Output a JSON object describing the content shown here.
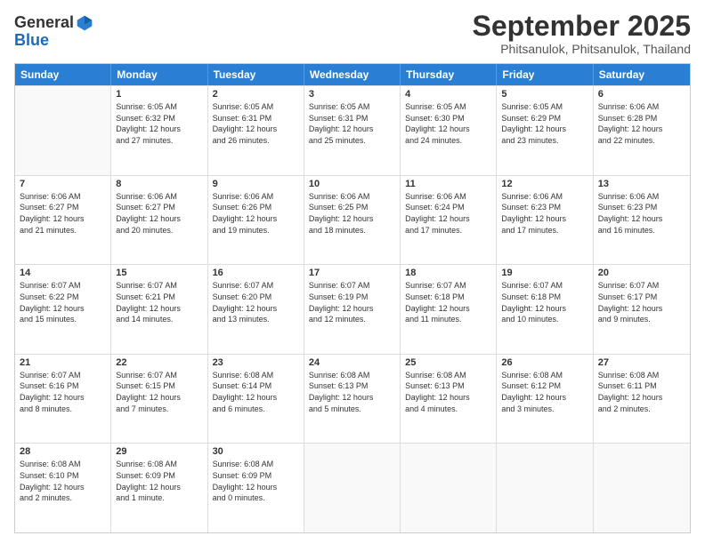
{
  "header": {
    "logo_line1": "General",
    "logo_line2": "Blue",
    "month_title": "September 2025",
    "location": "Phitsanulok, Phitsanulok, Thailand"
  },
  "weekdays": [
    "Sunday",
    "Monday",
    "Tuesday",
    "Wednesday",
    "Thursday",
    "Friday",
    "Saturday"
  ],
  "weeks": [
    [
      {
        "day": "",
        "empty": true
      },
      {
        "day": "1",
        "sunrise": "6:05 AM",
        "sunset": "6:32 PM",
        "daylight": "12 hours and 27 minutes."
      },
      {
        "day": "2",
        "sunrise": "6:05 AM",
        "sunset": "6:31 PM",
        "daylight": "12 hours and 26 minutes."
      },
      {
        "day": "3",
        "sunrise": "6:05 AM",
        "sunset": "6:31 PM",
        "daylight": "12 hours and 25 minutes."
      },
      {
        "day": "4",
        "sunrise": "6:05 AM",
        "sunset": "6:30 PM",
        "daylight": "12 hours and 24 minutes."
      },
      {
        "day": "5",
        "sunrise": "6:05 AM",
        "sunset": "6:29 PM",
        "daylight": "12 hours and 23 minutes."
      },
      {
        "day": "6",
        "sunrise": "6:06 AM",
        "sunset": "6:28 PM",
        "daylight": "12 hours and 22 minutes."
      }
    ],
    [
      {
        "day": "7",
        "sunrise": "6:06 AM",
        "sunset": "6:27 PM",
        "daylight": "12 hours and 21 minutes."
      },
      {
        "day": "8",
        "sunrise": "6:06 AM",
        "sunset": "6:27 PM",
        "daylight": "12 hours and 20 minutes."
      },
      {
        "day": "9",
        "sunrise": "6:06 AM",
        "sunset": "6:26 PM",
        "daylight": "12 hours and 19 minutes."
      },
      {
        "day": "10",
        "sunrise": "6:06 AM",
        "sunset": "6:25 PM",
        "daylight": "12 hours and 18 minutes."
      },
      {
        "day": "11",
        "sunrise": "6:06 AM",
        "sunset": "6:24 PM",
        "daylight": "12 hours and 17 minutes."
      },
      {
        "day": "12",
        "sunrise": "6:06 AM",
        "sunset": "6:23 PM",
        "daylight": "12 hours and 17 minutes."
      },
      {
        "day": "13",
        "sunrise": "6:06 AM",
        "sunset": "6:23 PM",
        "daylight": "12 hours and 16 minutes."
      }
    ],
    [
      {
        "day": "14",
        "sunrise": "6:07 AM",
        "sunset": "6:22 PM",
        "daylight": "12 hours and 15 minutes."
      },
      {
        "day": "15",
        "sunrise": "6:07 AM",
        "sunset": "6:21 PM",
        "daylight": "12 hours and 14 minutes."
      },
      {
        "day": "16",
        "sunrise": "6:07 AM",
        "sunset": "6:20 PM",
        "daylight": "12 hours and 13 minutes."
      },
      {
        "day": "17",
        "sunrise": "6:07 AM",
        "sunset": "6:19 PM",
        "daylight": "12 hours and 12 minutes."
      },
      {
        "day": "18",
        "sunrise": "6:07 AM",
        "sunset": "6:18 PM",
        "daylight": "12 hours and 11 minutes."
      },
      {
        "day": "19",
        "sunrise": "6:07 AM",
        "sunset": "6:18 PM",
        "daylight": "12 hours and 10 minutes."
      },
      {
        "day": "20",
        "sunrise": "6:07 AM",
        "sunset": "6:17 PM",
        "daylight": "12 hours and 9 minutes."
      }
    ],
    [
      {
        "day": "21",
        "sunrise": "6:07 AM",
        "sunset": "6:16 PM",
        "daylight": "12 hours and 8 minutes."
      },
      {
        "day": "22",
        "sunrise": "6:07 AM",
        "sunset": "6:15 PM",
        "daylight": "12 hours and 7 minutes."
      },
      {
        "day": "23",
        "sunrise": "6:08 AM",
        "sunset": "6:14 PM",
        "daylight": "12 hours and 6 minutes."
      },
      {
        "day": "24",
        "sunrise": "6:08 AM",
        "sunset": "6:13 PM",
        "daylight": "12 hours and 5 minutes."
      },
      {
        "day": "25",
        "sunrise": "6:08 AM",
        "sunset": "6:13 PM",
        "daylight": "12 hours and 4 minutes."
      },
      {
        "day": "26",
        "sunrise": "6:08 AM",
        "sunset": "6:12 PM",
        "daylight": "12 hours and 3 minutes."
      },
      {
        "day": "27",
        "sunrise": "6:08 AM",
        "sunset": "6:11 PM",
        "daylight": "12 hours and 2 minutes."
      }
    ],
    [
      {
        "day": "28",
        "sunrise": "6:08 AM",
        "sunset": "6:10 PM",
        "daylight": "12 hours and 2 minutes."
      },
      {
        "day": "29",
        "sunrise": "6:08 AM",
        "sunset": "6:09 PM",
        "daylight": "12 hours and 1 minute."
      },
      {
        "day": "30",
        "sunrise": "6:08 AM",
        "sunset": "6:09 PM",
        "daylight": "12 hours and 0 minutes."
      },
      {
        "day": "",
        "empty": true
      },
      {
        "day": "",
        "empty": true
      },
      {
        "day": "",
        "empty": true
      },
      {
        "day": "",
        "empty": true
      }
    ]
  ]
}
